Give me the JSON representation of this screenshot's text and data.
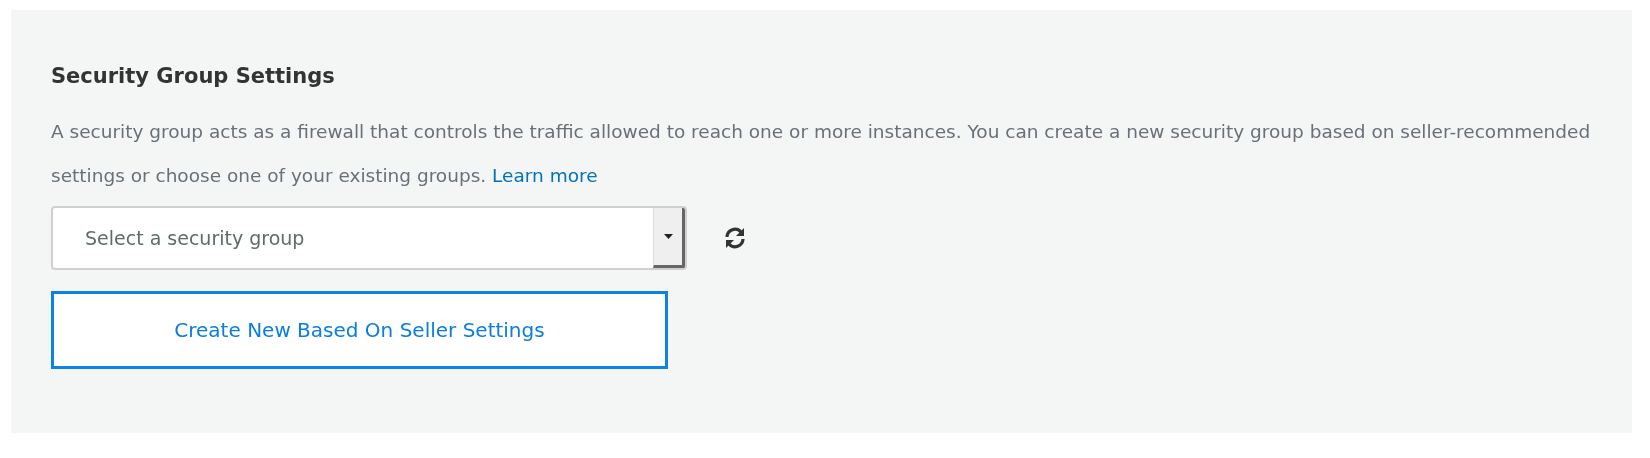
{
  "section": {
    "title": "Security Group Settings",
    "description": "A security group acts as a firewall that controls the traffic allowed to reach one or more instances. You can create a new security group based on seller-recommended settings or choose one of your existing groups.",
    "link": "Learn more"
  },
  "security_group_select": {
    "placeholder": "Select a security group"
  },
  "create_button": {
    "label": "Create New Based On Seller Settings"
  }
}
